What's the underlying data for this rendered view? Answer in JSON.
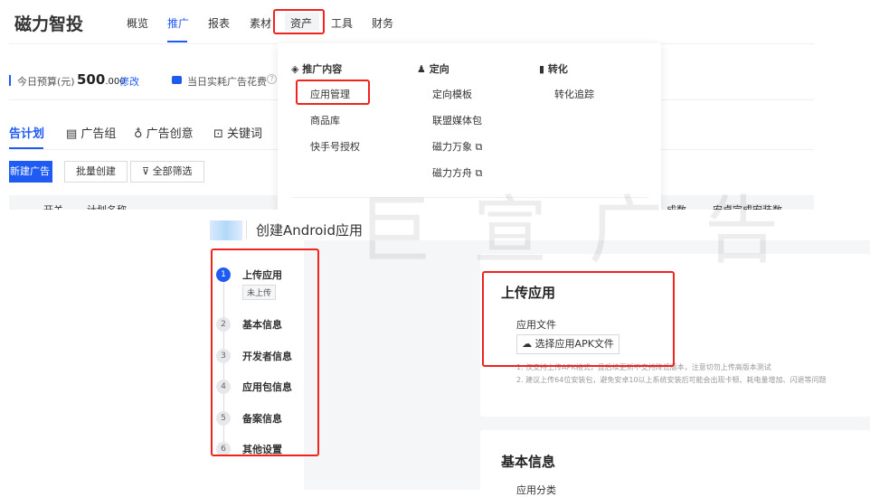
{
  "header": {
    "logo": "磁力智投",
    "nav": [
      "概览",
      "推广",
      "报表",
      "素材",
      "资产",
      "工具",
      "财务"
    ],
    "active": "推广",
    "highlighted": "资产"
  },
  "budget": {
    "label": "今日预算(元)",
    "value_int": "500",
    "value_dec": ".000",
    "edit": "修改",
    "spend_label": "当日实耗广告花费"
  },
  "tabs": [
    "告计划",
    "广告组",
    "广告创意",
    "关键词"
  ],
  "buttons": {
    "new_ad": "新建广告",
    "batch": "批量创建",
    "filter": "全部筛选"
  },
  "table_headers": [
    "开关",
    "计划名称",
    "成数",
    "安卓完成安装数"
  ],
  "dropdown": {
    "columns": [
      {
        "title": "推广内容",
        "icon": "layers-icon",
        "items": [
          "应用管理",
          "商品库",
          "快手号授权"
        ]
      },
      {
        "title": "定向",
        "icon": "user-icon",
        "items": [
          "定向模板",
          "联盟媒体包",
          "磁力万象",
          "磁力方舟"
        ]
      },
      {
        "title": "转化",
        "icon": "bar-chart-icon",
        "items": [
          "转化追踪"
        ]
      }
    ]
  },
  "watermark": "巨宣广告",
  "create": {
    "title": "创建Android应用",
    "steps": [
      {
        "n": "1",
        "label": "上传应用",
        "status": "未上传"
      },
      {
        "n": "2",
        "label": "基本信息"
      },
      {
        "n": "3",
        "label": "开发者信息"
      },
      {
        "n": "4",
        "label": "应用包信息"
      },
      {
        "n": "5",
        "label": "备案信息"
      },
      {
        "n": "6",
        "label": "其他设置"
      }
    ],
    "upload": {
      "heading": "上传应用",
      "field_label": "应用文件",
      "button": "选择应用APK文件",
      "tips": [
        "1. 仅支持上传APK格式，且后续更新不支持降低版本，注意切勿上传高版本测试",
        "2. 建议上传64位安装包，避免安卓10以上系统安装后可能会出现卡顿、耗电量增加、闪退等问题"
      ]
    },
    "basic": {
      "heading": "基本信息",
      "field_label": "应用分类"
    }
  },
  "colors": {
    "primary": "#1f5bf2",
    "highlight": "#f0231e"
  }
}
